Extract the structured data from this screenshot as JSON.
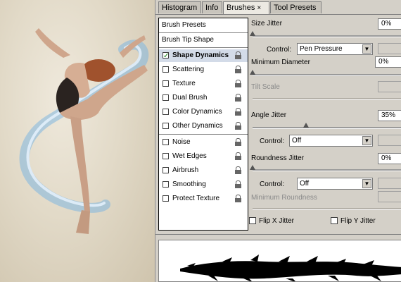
{
  "tabs": [
    {
      "label": "Histogram"
    },
    {
      "label": "Info"
    },
    {
      "label": "Brushes",
      "close": "×"
    },
    {
      "label": "Tool Presets"
    }
  ],
  "list": {
    "header": "Brush Presets",
    "section": "Brush Tip Shape",
    "items": [
      {
        "label": "Shape Dynamics",
        "checked": true
      },
      {
        "label": "Scattering",
        "checked": false
      },
      {
        "label": "Texture",
        "checked": false
      },
      {
        "label": "Dual Brush",
        "checked": false
      },
      {
        "label": "Color Dynamics",
        "checked": false
      },
      {
        "label": "Other Dynamics",
        "checked": false
      },
      {
        "label": "Noise",
        "checked": false
      },
      {
        "label": "Wet Edges",
        "checked": false
      },
      {
        "label": "Airbrush",
        "checked": false
      },
      {
        "label": "Smoothing",
        "checked": false
      },
      {
        "label": "Protect Texture",
        "checked": false
      }
    ]
  },
  "settings": {
    "size_jitter": {
      "label": "Size Jitter",
      "value": "0%"
    },
    "control1": {
      "label": "Control:",
      "value": "Pen Pressure"
    },
    "min_diameter": {
      "label": "Minimum Diameter",
      "value": "0%"
    },
    "tilt_scale": {
      "label": "Tilt Scale"
    },
    "angle_jitter": {
      "label": "Angle Jitter",
      "value": "35%"
    },
    "control2": {
      "label": "Control:",
      "value": "Off"
    },
    "roundness_jitter": {
      "label": "Roundness Jitter",
      "value": "0%"
    },
    "control3": {
      "label": "Control:",
      "value": "Off"
    },
    "min_roundness": {
      "label": "Minimum Roundness"
    },
    "flip_x": {
      "label": "Flip X Jitter",
      "checked": false
    },
    "flip_y": {
      "label": "Flip Y Jitter",
      "checked": false
    }
  },
  "colors": {
    "accent": "#d3dbe8",
    "panel": "#d4d0c8"
  },
  "sliders": {
    "size_jitter": 0,
    "min_diameter": 0,
    "angle_jitter": 0.35,
    "roundness_jitter": 0
  }
}
